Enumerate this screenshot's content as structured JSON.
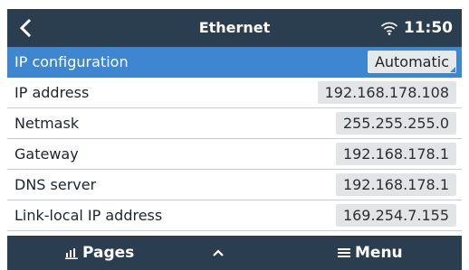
{
  "header": {
    "back_icon": "chevron-left-icon",
    "title": "Ethernet",
    "wifi_icon": "wifi-icon",
    "time": "11:50"
  },
  "rows": [
    {
      "label": "IP configuration",
      "value": "Automatic",
      "selected": true
    },
    {
      "label": "IP address",
      "value": "192.168.178.108"
    },
    {
      "label": "Netmask",
      "value": "255.255.255.0"
    },
    {
      "label": "Gateway",
      "value": "192.168.178.1"
    },
    {
      "label": "DNS server",
      "value": "192.168.178.1"
    },
    {
      "label": "Link-local IP address",
      "value": "169.254.7.155"
    }
  ],
  "footer": {
    "pages_icon": "bar-chart-icon",
    "pages_label": "Pages",
    "up_icon": "chevron-up-icon",
    "menu_icon": "hamburger-menu-icon",
    "menu_label": "Menu"
  },
  "colors": {
    "bar_background": "#2b3e50",
    "selected_row": "#3f86d0",
    "value_box": "#e3e4e5"
  }
}
